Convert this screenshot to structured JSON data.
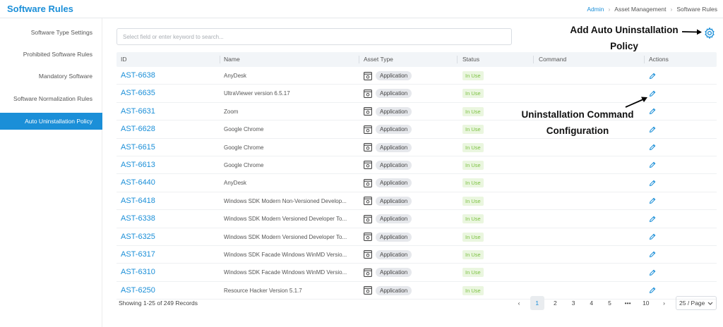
{
  "header": {
    "title": "Software Rules",
    "breadcrumb": [
      "Admin",
      "Asset Management",
      "Software Rules"
    ]
  },
  "sidebar": {
    "items": [
      {
        "label": "Software Type Settings",
        "active": false
      },
      {
        "label": "Prohibited Software Rules",
        "active": false
      },
      {
        "label": "Mandatory Software",
        "active": false
      },
      {
        "label": "Software Normalization Rules",
        "active": false
      },
      {
        "label": "Auto Uninstallation Policy",
        "active": true
      }
    ]
  },
  "search": {
    "placeholder": "Select field or enter keyword to search..."
  },
  "table": {
    "columns": [
      "ID",
      "Name",
      "Asset Type",
      "Status",
      "Command",
      "Actions"
    ],
    "rows": [
      {
        "id": "AST-6638",
        "name": "AnyDesk",
        "asset_type": "Application",
        "status": "In Use"
      },
      {
        "id": "AST-6635",
        "name": "UltraViewer version 6.5.17",
        "asset_type": "Application",
        "status": "In Use"
      },
      {
        "id": "AST-6631",
        "name": "Zoom",
        "asset_type": "Application",
        "status": "In Use"
      },
      {
        "id": "AST-6628",
        "name": "Google Chrome",
        "asset_type": "Application",
        "status": "In Use"
      },
      {
        "id": "AST-6615",
        "name": "Google Chrome",
        "asset_type": "Application",
        "status": "In Use"
      },
      {
        "id": "AST-6613",
        "name": "Google Chrome",
        "asset_type": "Application",
        "status": "In Use"
      },
      {
        "id": "AST-6440",
        "name": "AnyDesk",
        "asset_type": "Application",
        "status": "In Use"
      },
      {
        "id": "AST-6418",
        "name": "Windows SDK Modern Non-Versioned Develop...",
        "asset_type": "Application",
        "status": "In Use"
      },
      {
        "id": "AST-6338",
        "name": "Windows SDK Modern Versioned Developer To...",
        "asset_type": "Application",
        "status": "In Use"
      },
      {
        "id": "AST-6325",
        "name": "Windows SDK Modern Versioned Developer To...",
        "asset_type": "Application",
        "status": "In Use"
      },
      {
        "id": "AST-6317",
        "name": "Windows SDK Facade Windows WinMD Versio...",
        "asset_type": "Application",
        "status": "In Use"
      },
      {
        "id": "AST-6310",
        "name": "Windows SDK Facade Windows WinMD Versio...",
        "asset_type": "Application",
        "status": "In Use"
      },
      {
        "id": "AST-6250",
        "name": "Resource Hacker Version 5.1.7",
        "asset_type": "Application",
        "status": "In Use"
      }
    ]
  },
  "footer": {
    "records": "Showing 1-25 of 249 Records",
    "pages": [
      "1",
      "2",
      "3",
      "4",
      "5",
      "•••",
      "10"
    ],
    "current_page": "1",
    "prev": "‹",
    "next": "›",
    "page_size": "25 / Page"
  },
  "annotations": {
    "gear_callout": [
      "Add Auto Uninstallation",
      "Policy"
    ],
    "edit_callout": [
      "Uninstallation Command",
      "Configuration"
    ]
  },
  "colors": {
    "accent": "#1b8fd8",
    "status_green": "#7cc142",
    "status_bg": "#eaf6df"
  },
  "icons": [
    "gear-icon",
    "application-icon",
    "edit-pencil-icon",
    "chevron-down-icon",
    "arrow-icon"
  ]
}
